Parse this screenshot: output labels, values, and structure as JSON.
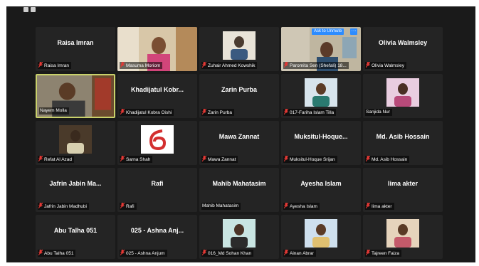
{
  "ask_to_unmute_label": "Ask to Unmute",
  "more_label": "···",
  "participants": [
    {
      "name": "Raisa Imran",
      "caption": "Raisa Imran",
      "muted": true,
      "kind": "name"
    },
    {
      "name": "Masuma Moriom",
      "caption": "Masuma Moriom",
      "muted": true,
      "kind": "video"
    },
    {
      "name": "Zuhair Ahmed Kowshik",
      "caption": "Zuhair Ahmed Kowshik",
      "muted": true,
      "kind": "avatar"
    },
    {
      "name": "Paromita Sen (Shefali)",
      "caption": "Paromita Sen (Shefali) 18...",
      "muted": true,
      "kind": "video"
    },
    {
      "name": "Olivia Walmsley",
      "caption": "Olivia Walmsley",
      "muted": true,
      "kind": "name"
    },
    {
      "name": "Nayem Molla",
      "caption": "Nayem Molla",
      "muted": false,
      "kind": "video",
      "speaking": true
    },
    {
      "name": "Khadijatul Kobr...",
      "caption": "Khadijatul Kobra Oishi",
      "muted": true,
      "kind": "name"
    },
    {
      "name": "Zarin Purba",
      "caption": "Zarin Purba",
      "muted": true,
      "kind": "name"
    },
    {
      "name": "017-Fariha Islam Tilla",
      "caption": "017-Fariha Islam Tilla",
      "muted": true,
      "kind": "avatar"
    },
    {
      "name": "Sanjida Nur",
      "caption": "Sanjida Nur",
      "muted": false,
      "kind": "avatar"
    },
    {
      "name": "Refat Al Azad",
      "caption": "Refat Al Azad",
      "muted": true,
      "kind": "avatar"
    },
    {
      "name": "Sarna Shah",
      "caption": "Sarna Shah",
      "muted": true,
      "kind": "logo"
    },
    {
      "name": "Mawa Zannat",
      "caption": "Mawa Zannat",
      "muted": true,
      "kind": "name"
    },
    {
      "name": "Muksitul-Hoque...",
      "caption": "Muksitul-Hoque Srijan",
      "muted": true,
      "kind": "name"
    },
    {
      "name": "Md. Asib Hossain",
      "caption": "Md. Asib Hossain",
      "muted": true,
      "kind": "name"
    },
    {
      "name": "Jafrin Jabin Ma...",
      "caption": "Jafrin Jabin Madhubi",
      "muted": true,
      "kind": "name"
    },
    {
      "name": "Rafi",
      "caption": "Rafi",
      "muted": true,
      "kind": "name"
    },
    {
      "name": "Mahib Mahatasim",
      "caption": "Mahib Mahatasim",
      "muted": false,
      "kind": "name"
    },
    {
      "name": "Ayesha Islam",
      "caption": "Ayesha Islam",
      "muted": true,
      "kind": "name"
    },
    {
      "name": "Iima akter",
      "caption": "Iima akter",
      "muted": true,
      "kind": "name"
    },
    {
      "name": "Abu Talha 051",
      "caption": "Abu Talha 051",
      "muted": true,
      "kind": "name"
    },
    {
      "name": "025 - Ashna Anj...",
      "caption": "025 - Ashna Anjum",
      "muted": true,
      "kind": "name"
    },
    {
      "name": "016_Md Sohan Khan",
      "caption": "016_Md Sohan Khan",
      "muted": true,
      "kind": "avatar"
    },
    {
      "name": "Ainan Abrar",
      "caption": "Ainan Abrar",
      "muted": true,
      "kind": "avatar"
    },
    {
      "name": "Tajreen Faiza",
      "caption": "Tajreen Faiza",
      "muted": true,
      "kind": "avatar"
    }
  ]
}
